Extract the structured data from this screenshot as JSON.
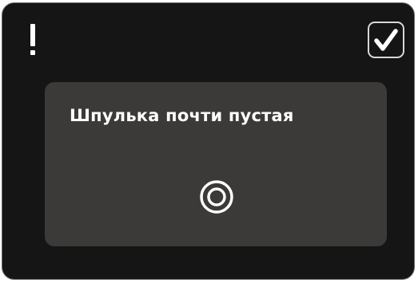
{
  "dialog": {
    "message": "Шпулька почти пустая",
    "warning_icon": "exclamation-icon",
    "confirm_icon": "checkmark-icon",
    "bobbin_icon": "bobbin-icon"
  },
  "colors": {
    "background": "#151515",
    "panel": "#3c3a38",
    "text": "#ffffff",
    "button_border": "#d8d8d8"
  }
}
